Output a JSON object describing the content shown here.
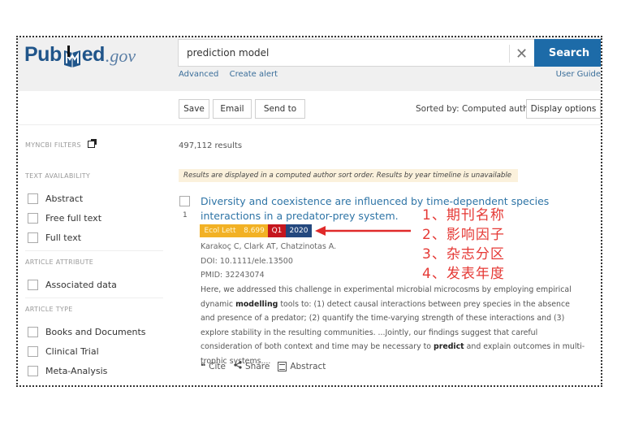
{
  "header": {
    "logo": {
      "pub": "Pub",
      "med": "ed",
      "gov": ".gov"
    },
    "search": {
      "value": "prediction model",
      "placeholder": ""
    },
    "search_button": "Search",
    "links": {
      "advanced": "Advanced",
      "create_alert": "Create alert",
      "user_guide": "User Guide"
    },
    "brand_color": "#1d6ba8"
  },
  "toolbar": {
    "save": "Save",
    "email": "Email",
    "send_to": "Send to",
    "sorted_by": "Sorted by: Computed author",
    "display_options": "Display options"
  },
  "sidebar": {
    "myncbi_filters": "MYNCBI FILTERS",
    "sections": [
      {
        "heading": "TEXT AVAILABILITY",
        "items": [
          "Abstract",
          "Free full text",
          "Full text"
        ]
      },
      {
        "heading": "ARTICLE ATTRIBUTE",
        "items": [
          "Associated data"
        ]
      },
      {
        "heading": "ARTICLE TYPE",
        "items": [
          "Books and Documents",
          "Clinical Trial",
          "Meta-Analysis"
        ]
      }
    ]
  },
  "results": {
    "count": "497,112 results",
    "notice": "Results are displayed in a computed author sort order. Results by year timeline is unavailable",
    "items": [
      {
        "number": "1",
        "title": "Diversity and coexistence are influenced by time-dependent species interactions in a predator-prey system.",
        "badges": {
          "journal": "Ecol Lett",
          "impact_factor": "8.699",
          "quartile": "Q1",
          "year": "2020"
        },
        "authors": "Karakoç C, Clark AT, Chatzinotas A.",
        "doi": "DOI: 10.1111/ele.13500",
        "pmid": "PMID: 32243074",
        "snippet": {
          "s1": "Here, we addressed this challenge in experimental microbial microcosms by employing empirical dynamic ",
          "b1": "modelling",
          "s2": " tools to: (1) detect causal interactions between prey species in the absence and presence of a predator; (2) quantify the time-varying strength of these interactions and (3) explore stability in the resulting communities. ...Jointly, our findings suggest that careful consideration of both context and time may be necessary to ",
          "b2": "predict",
          "s3": " and explain outcomes in multi-trophic systems...."
        },
        "actions": {
          "cite": "Cite",
          "share": "Share",
          "abstract": "Abstract"
        }
      }
    ]
  },
  "annotations": {
    "lines": [
      "1、期刊名称",
      "2、影响因子",
      "3、杂志分区",
      "4、发表年度"
    ],
    "color": "#e53935"
  },
  "badge_colors": {
    "journal": "#f2b125",
    "quartile": "#c5161d",
    "year": "#24487e"
  }
}
